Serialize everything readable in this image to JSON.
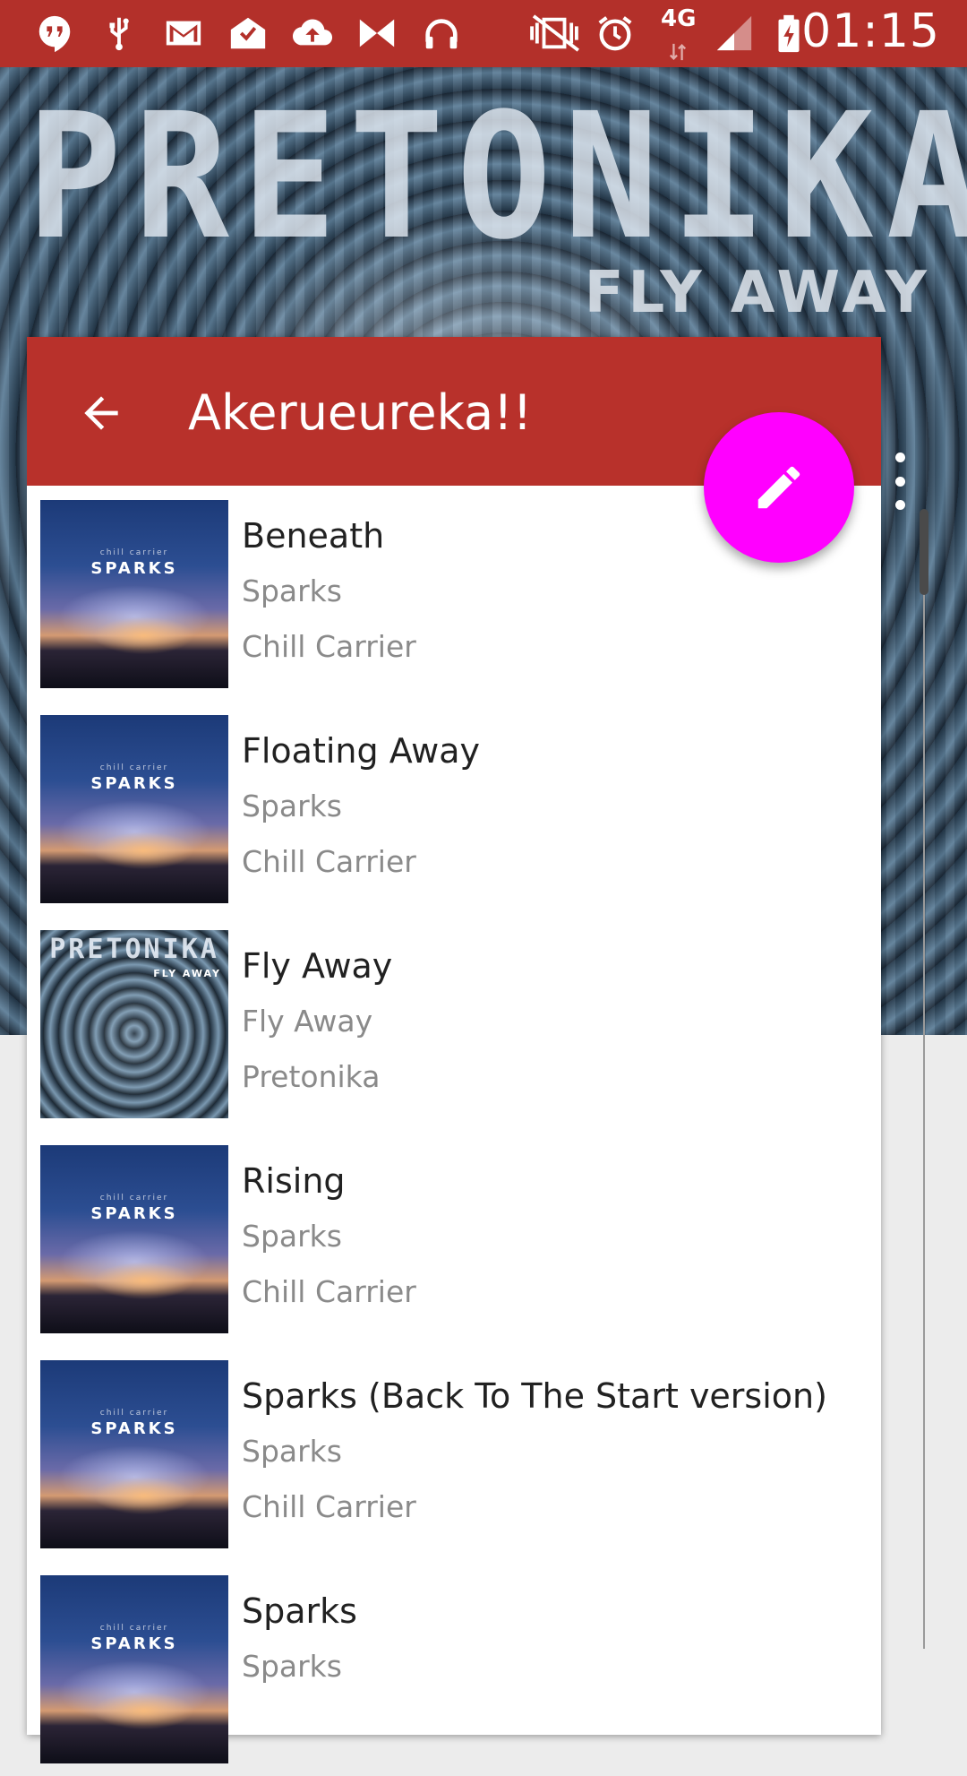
{
  "status_bar": {
    "time": "01:15",
    "network": "4G",
    "icons": [
      "hangouts-icon",
      "usb-icon",
      "gmail-icon",
      "mail-check-icon",
      "cloud-upload-icon",
      "bowtie-icon",
      "headphones-icon",
      "mute-vibrate-icon",
      "alarm-icon",
      "signal-icon",
      "battery-charging-icon"
    ]
  },
  "header": {
    "artwork_title": "PRETONIKA",
    "artwork_subtitle": "FLY AWAY"
  },
  "toolbar": {
    "title": "Akerueureka!!"
  },
  "colors": {
    "status_bar": "#b3302a",
    "toolbar": "#b8312b",
    "fab": "#ff00ff"
  },
  "songs": [
    {
      "title": "Beneath",
      "album": "Sparks",
      "artist": "Chill Carrier",
      "art": "SPARKS"
    },
    {
      "title": "Floating Away",
      "album": "Sparks",
      "artist": "Chill Carrier",
      "art": "SPARKS"
    },
    {
      "title": "Fly Away",
      "album": "Fly Away",
      "artist": "Pretonika",
      "art": "PRETONIKA",
      "art_sub": "FLY AWAY"
    },
    {
      "title": "Rising",
      "album": "Sparks",
      "artist": "Chill Carrier",
      "art": "SPARKS"
    },
    {
      "title": "Sparks (Back To The Start version)",
      "album": "Sparks",
      "artist": "Chill Carrier",
      "art": "SPARKS"
    },
    {
      "title": "Sparks",
      "album": "Sparks",
      "artist": "",
      "art": "SPARKS"
    }
  ],
  "thumb_small": "chill carrier"
}
